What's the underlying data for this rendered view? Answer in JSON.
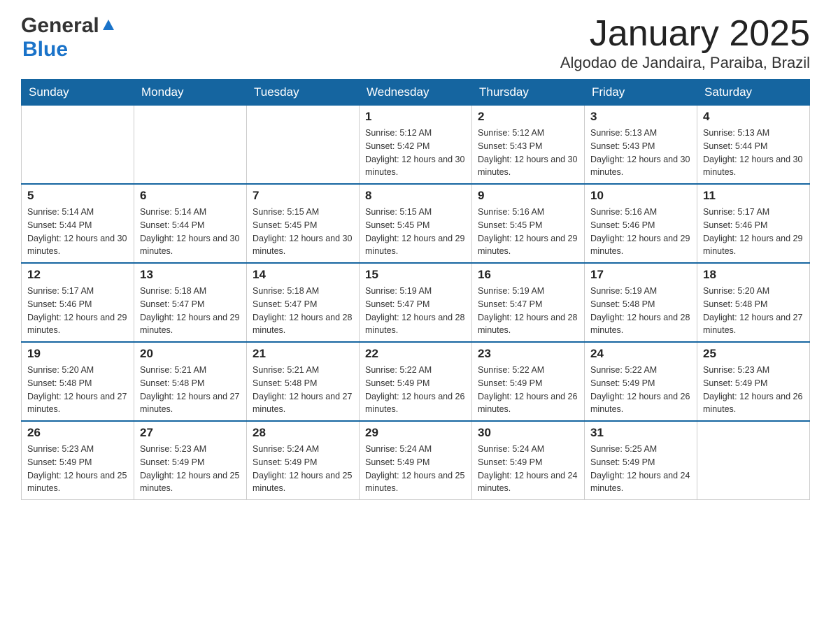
{
  "header": {
    "logo_general": "General",
    "logo_blue": "Blue",
    "month_title": "January 2025",
    "location": "Algodao de Jandaira, Paraiba, Brazil"
  },
  "weekdays": [
    "Sunday",
    "Monday",
    "Tuesday",
    "Wednesday",
    "Thursday",
    "Friday",
    "Saturday"
  ],
  "weeks": [
    [
      {
        "day": "",
        "info": ""
      },
      {
        "day": "",
        "info": ""
      },
      {
        "day": "",
        "info": ""
      },
      {
        "day": "1",
        "info": "Sunrise: 5:12 AM\nSunset: 5:42 PM\nDaylight: 12 hours and 30 minutes."
      },
      {
        "day": "2",
        "info": "Sunrise: 5:12 AM\nSunset: 5:43 PM\nDaylight: 12 hours and 30 minutes."
      },
      {
        "day": "3",
        "info": "Sunrise: 5:13 AM\nSunset: 5:43 PM\nDaylight: 12 hours and 30 minutes."
      },
      {
        "day": "4",
        "info": "Sunrise: 5:13 AM\nSunset: 5:44 PM\nDaylight: 12 hours and 30 minutes."
      }
    ],
    [
      {
        "day": "5",
        "info": "Sunrise: 5:14 AM\nSunset: 5:44 PM\nDaylight: 12 hours and 30 minutes."
      },
      {
        "day": "6",
        "info": "Sunrise: 5:14 AM\nSunset: 5:44 PM\nDaylight: 12 hours and 30 minutes."
      },
      {
        "day": "7",
        "info": "Sunrise: 5:15 AM\nSunset: 5:45 PM\nDaylight: 12 hours and 30 minutes."
      },
      {
        "day": "8",
        "info": "Sunrise: 5:15 AM\nSunset: 5:45 PM\nDaylight: 12 hours and 29 minutes."
      },
      {
        "day": "9",
        "info": "Sunrise: 5:16 AM\nSunset: 5:45 PM\nDaylight: 12 hours and 29 minutes."
      },
      {
        "day": "10",
        "info": "Sunrise: 5:16 AM\nSunset: 5:46 PM\nDaylight: 12 hours and 29 minutes."
      },
      {
        "day": "11",
        "info": "Sunrise: 5:17 AM\nSunset: 5:46 PM\nDaylight: 12 hours and 29 minutes."
      }
    ],
    [
      {
        "day": "12",
        "info": "Sunrise: 5:17 AM\nSunset: 5:46 PM\nDaylight: 12 hours and 29 minutes."
      },
      {
        "day": "13",
        "info": "Sunrise: 5:18 AM\nSunset: 5:47 PM\nDaylight: 12 hours and 29 minutes."
      },
      {
        "day": "14",
        "info": "Sunrise: 5:18 AM\nSunset: 5:47 PM\nDaylight: 12 hours and 28 minutes."
      },
      {
        "day": "15",
        "info": "Sunrise: 5:19 AM\nSunset: 5:47 PM\nDaylight: 12 hours and 28 minutes."
      },
      {
        "day": "16",
        "info": "Sunrise: 5:19 AM\nSunset: 5:47 PM\nDaylight: 12 hours and 28 minutes."
      },
      {
        "day": "17",
        "info": "Sunrise: 5:19 AM\nSunset: 5:48 PM\nDaylight: 12 hours and 28 minutes."
      },
      {
        "day": "18",
        "info": "Sunrise: 5:20 AM\nSunset: 5:48 PM\nDaylight: 12 hours and 27 minutes."
      }
    ],
    [
      {
        "day": "19",
        "info": "Sunrise: 5:20 AM\nSunset: 5:48 PM\nDaylight: 12 hours and 27 minutes."
      },
      {
        "day": "20",
        "info": "Sunrise: 5:21 AM\nSunset: 5:48 PM\nDaylight: 12 hours and 27 minutes."
      },
      {
        "day": "21",
        "info": "Sunrise: 5:21 AM\nSunset: 5:48 PM\nDaylight: 12 hours and 27 minutes."
      },
      {
        "day": "22",
        "info": "Sunrise: 5:22 AM\nSunset: 5:49 PM\nDaylight: 12 hours and 26 minutes."
      },
      {
        "day": "23",
        "info": "Sunrise: 5:22 AM\nSunset: 5:49 PM\nDaylight: 12 hours and 26 minutes."
      },
      {
        "day": "24",
        "info": "Sunrise: 5:22 AM\nSunset: 5:49 PM\nDaylight: 12 hours and 26 minutes."
      },
      {
        "day": "25",
        "info": "Sunrise: 5:23 AM\nSunset: 5:49 PM\nDaylight: 12 hours and 26 minutes."
      }
    ],
    [
      {
        "day": "26",
        "info": "Sunrise: 5:23 AM\nSunset: 5:49 PM\nDaylight: 12 hours and 25 minutes."
      },
      {
        "day": "27",
        "info": "Sunrise: 5:23 AM\nSunset: 5:49 PM\nDaylight: 12 hours and 25 minutes."
      },
      {
        "day": "28",
        "info": "Sunrise: 5:24 AM\nSunset: 5:49 PM\nDaylight: 12 hours and 25 minutes."
      },
      {
        "day": "29",
        "info": "Sunrise: 5:24 AM\nSunset: 5:49 PM\nDaylight: 12 hours and 25 minutes."
      },
      {
        "day": "30",
        "info": "Sunrise: 5:24 AM\nSunset: 5:49 PM\nDaylight: 12 hours and 24 minutes."
      },
      {
        "day": "31",
        "info": "Sunrise: 5:25 AM\nSunset: 5:49 PM\nDaylight: 12 hours and 24 minutes."
      },
      {
        "day": "",
        "info": ""
      }
    ]
  ]
}
